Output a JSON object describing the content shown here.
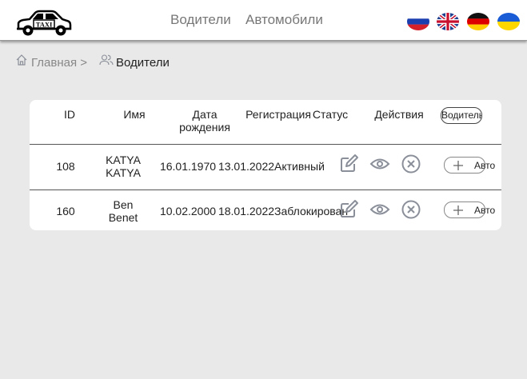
{
  "header": {
    "logo_text": "TAXI",
    "nav": [
      {
        "label": "Водители"
      },
      {
        "label": "Автомобили"
      }
    ],
    "flags": [
      "russian-flag",
      "uk-flag",
      "german-flag",
      "ukrainian-flag"
    ]
  },
  "breadcrumb": {
    "home_label": "Главная >",
    "current_label": "Водители"
  },
  "table": {
    "headers": {
      "id": "ID",
      "name": "Имя",
      "birth_line1": "Дата",
      "birth_line2": "рождения",
      "registration": "Регистрация",
      "status": "Статус",
      "actions": "Действия",
      "add_driver": "Водитель"
    },
    "rows": [
      {
        "id": "108",
        "name_line1": "KATYA",
        "name_line2": "KATYA",
        "birth": "16.01.1970",
        "registration": "13.01.2022",
        "status": "Активный",
        "add_car": "Авто"
      },
      {
        "id": "160",
        "name_line1": "Ben",
        "name_line2": "Benet",
        "birth": "10.02.2000",
        "registration": "18.01.2022",
        "status": "Заблокирован",
        "add_car": "Авто"
      }
    ]
  },
  "colors": {
    "background": "#e9e9e9",
    "icon_gray": "#8a8f99",
    "nav_text": "#777777"
  }
}
